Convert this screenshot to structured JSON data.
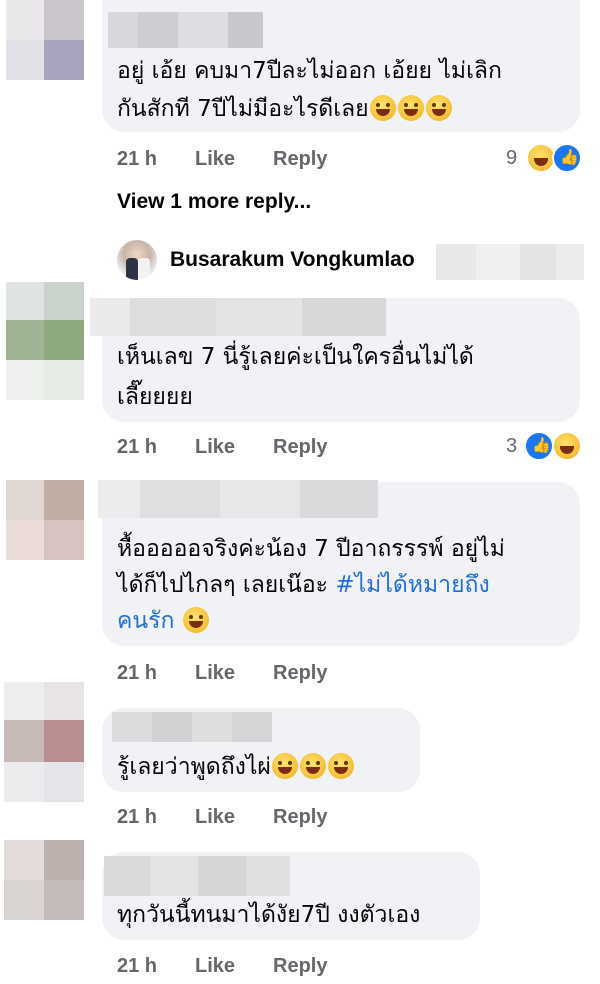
{
  "comments": [
    {
      "lines": [
        "อยู่ เอ้ย คบมา7ปีละไม่ออก เอ้ยย ไม่เลิก",
        "กันสักที 7ปีไม่มีอะไรดีเลย"
      ],
      "time": "21 h",
      "like": "Like",
      "reply": "Reply",
      "reaction_count": "9",
      "reactions": [
        "haha",
        "like"
      ]
    },
    {
      "lines": [
        "เห็นเลข 7 นี่รู้เลยค่ะเป็นใครอื่นไม่ได้",
        "เลี๊ยยยย"
      ],
      "time": "21 h",
      "like": "Like",
      "reply": "Reply",
      "reaction_count": "3",
      "reactions": [
        "like",
        "haha"
      ]
    },
    {
      "lines": [
        "หื้อออออจริงค่ะน้อง 7 ปีอาถรรรพ์ อยู่ไม่",
        "ได้ก็ไปไกลๆ เลยเน๊อะ "
      ],
      "hashtag_line1": "#ไม่ได้หมายถึง",
      "hashtag_line2": "คนรัก",
      "time": "21 h",
      "like": "Like",
      "reply": "Reply"
    },
    {
      "lines": [
        "รู้เลยว่าพูดถึงไผ่"
      ],
      "time": "21 h",
      "like": "Like",
      "reply": "Reply"
    },
    {
      "lines": [
        "ทุกวันนี้ทนมาได้งัย7ปี งงตัวเอง"
      ],
      "time": "21 h",
      "like": "Like",
      "reply": "Reply"
    }
  ],
  "view_more": "View 1 more reply...",
  "reply_preview": {
    "author": "Busarakum Vongkumlao"
  },
  "colors": {
    "bubble": "#f0f2f5",
    "meta": "#65676b",
    "hashtag": "#216fdb",
    "like_blue": "#1877f2"
  }
}
